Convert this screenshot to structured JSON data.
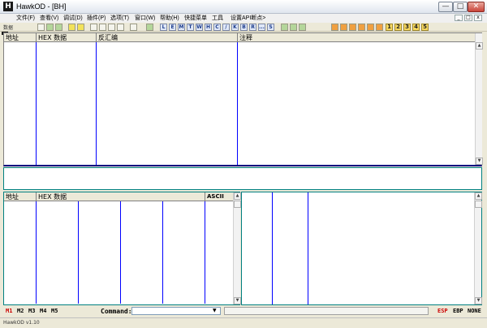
{
  "window": {
    "title": "HawkOD - [BH]",
    "app_icon": "H"
  },
  "menubar": {
    "items": [
      "文件(F)",
      "查看(V)",
      "调试(D)",
      "插件(P)",
      "选项(T)",
      "窗口(W)",
      "帮助(H)",
      "快捷菜单",
      "工具",
      "设置API断点>"
    ]
  },
  "toolbar": {
    "label": "数据",
    "letter_buttons": [
      "L",
      "E",
      "M",
      "T",
      "W",
      "H",
      "C",
      "/",
      "K",
      "B",
      "R",
      "...",
      "S"
    ],
    "number_buttons": [
      "1",
      "2",
      "3",
      "4",
      "5"
    ]
  },
  "disasm_pane": {
    "columns": [
      "地址",
      "HEX 数据",
      "反汇编",
      "注释"
    ]
  },
  "dump_pane": {
    "columns": [
      "地址",
      "HEX 数据",
      "ASCII"
    ]
  },
  "command_bar": {
    "markers": [
      "M1",
      "M2",
      "M3",
      "M4",
      "M5"
    ],
    "command_label": "Command:",
    "command_value": "",
    "dropdown_glyph": "▼",
    "registers": [
      "ESP",
      "EBP",
      "NONE"
    ]
  },
  "status": {
    "text": "HawkOD  v1.10"
  },
  "colors": {
    "accent_line": "#0000ff",
    "active_marker": "#cc0000",
    "divider": "#000080",
    "pane_border": "#008080"
  }
}
